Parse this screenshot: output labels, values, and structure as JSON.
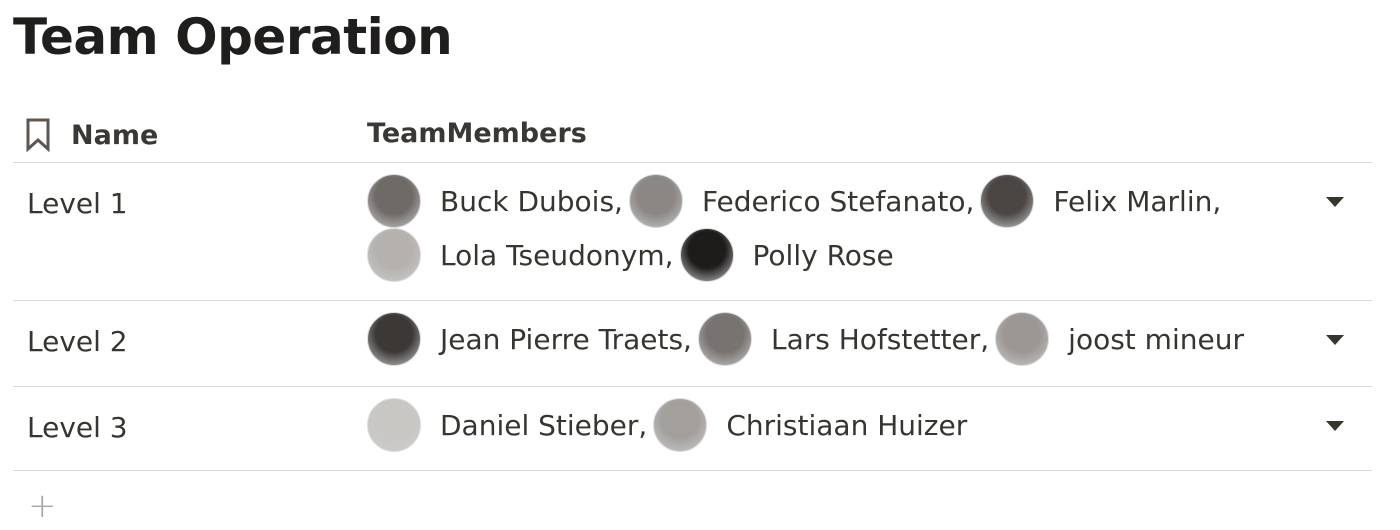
{
  "title": "Team Operation",
  "columns": {
    "name": "Name",
    "members": "TeamMembers"
  },
  "rows": [
    {
      "level": "Level 1",
      "members": [
        {
          "text": "Buck Dubois,",
          "avatar": "#6e6a66"
        },
        {
          "text": "Federico Stefanato,",
          "avatar": "#8a8784"
        },
        {
          "text": "Felix Marlin,",
          "avatar": "#4a4644"
        },
        {
          "text": "Lola Tseudonym,",
          "avatar": "#b5b2ae"
        },
        {
          "text": "Polly Rose",
          "avatar": "#1e1c1b"
        }
      ]
    },
    {
      "level": "Level 2",
      "members": [
        {
          "text": "Jean Pierre Traets,",
          "avatar": "#3b3836"
        },
        {
          "text": "Lars Hofstetter,",
          "avatar": "#77736f"
        },
        {
          "text": "joost mineur",
          "avatar": "#9a9794"
        }
      ]
    },
    {
      "level": "Level 3",
      "members": [
        {
          "text": "Daniel Stieber,",
          "avatar": "#c9c7c4"
        },
        {
          "text": "Christiaan Huizer",
          "avatar": "#a3a09c"
        }
      ]
    }
  ],
  "add_label": "+"
}
